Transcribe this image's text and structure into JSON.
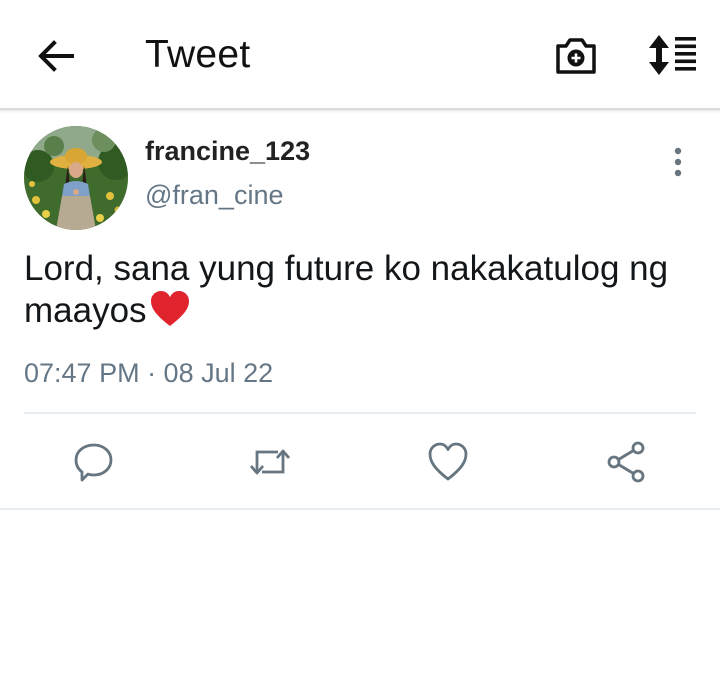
{
  "header": {
    "title": "Tweet",
    "icons": {
      "back": "arrow-left-icon",
      "camera": "camera-plus-icon",
      "sort": "sort-list-icon"
    }
  },
  "tweet": {
    "display_name": "francine_123",
    "handle": "@fran_cine",
    "text": "Lord, sana yung future ko nakakatulog ng maayos",
    "emoji": "red-heart-emoji",
    "timestamp": "07:47 PM · 08 Jul 22",
    "actions": [
      "reply-icon",
      "retweet-icon",
      "like-icon",
      "share-icon"
    ]
  },
  "colors": {
    "text_primary": "#14171a",
    "text_secondary": "#657786",
    "icon_gray": "#66757f",
    "divider": "#e6ecf0",
    "heart_red": "#e0242e"
  }
}
